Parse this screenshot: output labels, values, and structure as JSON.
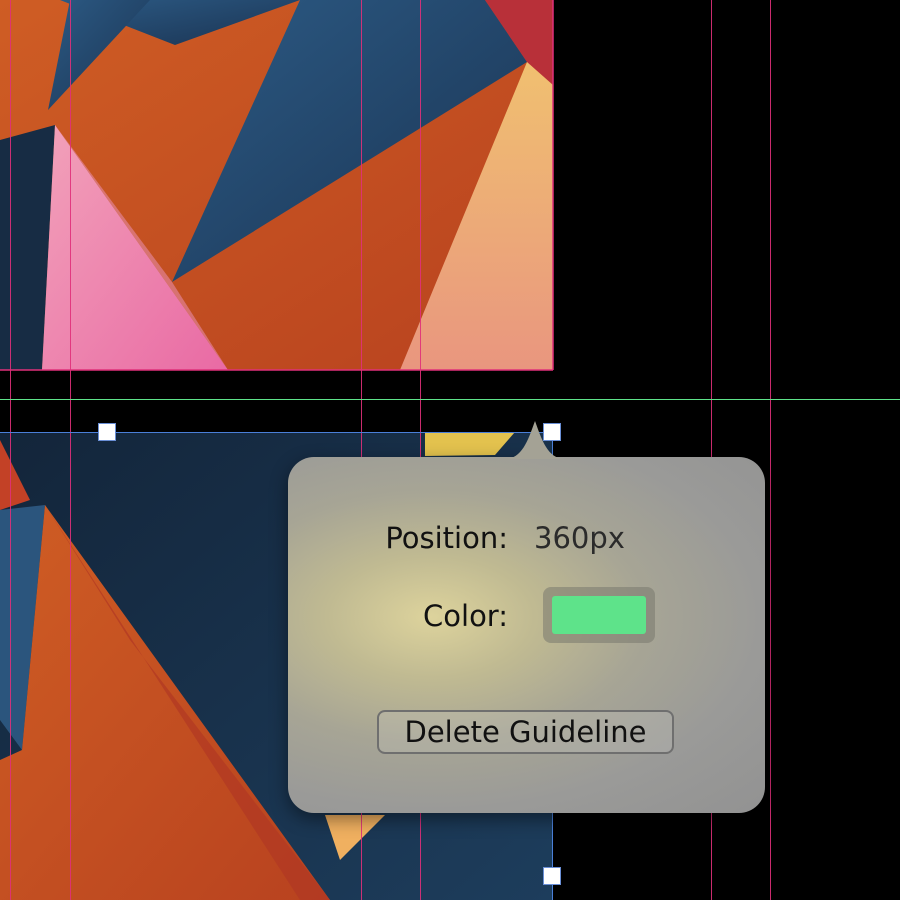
{
  "guideline_popover": {
    "position_label": "Position:",
    "position_value": "360px",
    "color_label": "Color:",
    "color_value": "#5ee38a",
    "delete_label": "Delete Guideline"
  },
  "colors": {
    "canvas_background": "#000000",
    "vertical_guide": "#e0307a",
    "selected_guide": "#5ee38a",
    "selection_bounds": "#4a7fd8",
    "artwork_orange": "#c94f23",
    "artwork_navy": "#1c3a5c",
    "artwork_pink": "#ec7aa8",
    "artwork_peach": "#ebaa78",
    "artwork_yellow": "#e3c24e"
  }
}
